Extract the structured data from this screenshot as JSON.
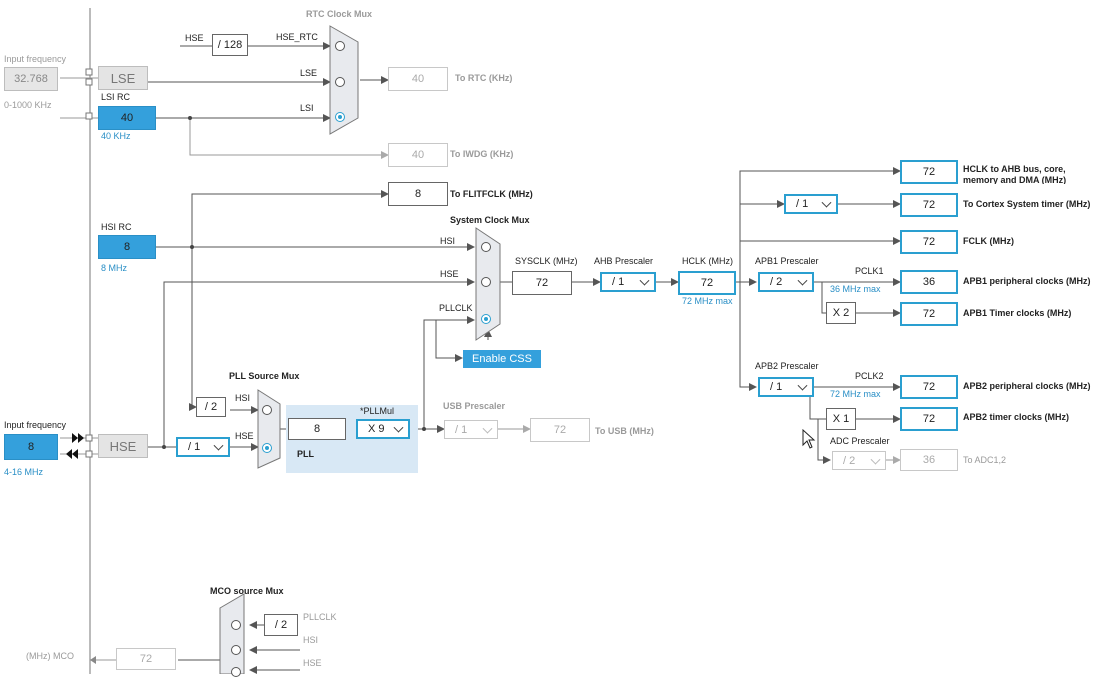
{
  "left": {
    "input_freq_label_top": "Input frequency",
    "lse_input_value": "32.768",
    "lse_range": "0-1000 KHz",
    "input_freq_label_bottom": "Input frequency",
    "hse_input_value": "8",
    "hse_range": "4-16 MHz",
    "mco_label": "(MHz) MCO",
    "mco_value": "72"
  },
  "sources": {
    "lse": "LSE",
    "lsi_rc_title": "LSI RC",
    "lsi_value": "40",
    "lsi_freq": "40 KHz",
    "hsi_rc_title": "HSI RC",
    "hsi_value": "8",
    "hsi_freq": "8 MHz",
    "hse": "HSE"
  },
  "rtc": {
    "title": "RTC Clock Mux",
    "hse_label": "HSE",
    "div128": "/ 128",
    "hse_rtc": "HSE_RTC",
    "lse_label": "LSE",
    "lsi_label": "LSI",
    "rtc_value": "40",
    "rtc_out": "To RTC (KHz)",
    "iwdg_value": "40",
    "iwdg_out": "To IWDG (KHz)"
  },
  "flit": {
    "value": "8",
    "label": "To FLITFCLK (MHz)"
  },
  "sysmux": {
    "title": "System Clock Mux",
    "hsi": "HSI",
    "hse": "HSE",
    "pllclk": "PLLCLK",
    "enable_css": "Enable CSS"
  },
  "sysclk": {
    "title": "SYSCLK (MHz)",
    "value": "72"
  },
  "ahb": {
    "title": "AHB Prescaler",
    "value": "/ 1"
  },
  "hclk": {
    "title": "HCLK (MHz)",
    "value": "72",
    "max": "72 MHz max"
  },
  "outputs": {
    "ahb_value": "72",
    "ahb_label_1": "HCLK to AHB bus, core,",
    "ahb_label_2": "memory and DMA (MHz)",
    "cortex_div": "/ 1",
    "cortex_value": "72",
    "cortex_label": "To Cortex System timer (MHz)",
    "fclk_value": "72",
    "fclk_label": "FCLK (MHz)"
  },
  "apb1": {
    "title": "APB1 Prescaler",
    "value": "/ 2",
    "pclk": "PCLK1",
    "max": "36 MHz max",
    "periph_value": "36",
    "periph_label": "APB1 peripheral clocks (MHz)",
    "timer_mult": "X 2",
    "timer_value": "72",
    "timer_label": "APB1 Timer clocks (MHz)"
  },
  "apb2": {
    "title": "APB2 Prescaler",
    "value": "/ 1",
    "pclk": "PCLK2",
    "max": "72 MHz max",
    "periph_value": "72",
    "periph_label": "APB2 peripheral clocks (MHz)",
    "timer_mult": "X 1",
    "timer_value": "72",
    "timer_label": "APB2 timer clocks (MHz)"
  },
  "adc": {
    "title": "ADC Prescaler",
    "value": "/ 2",
    "out": "36",
    "label": "To ADC1,2"
  },
  "pll": {
    "source_title": "PLL Source Mux",
    "hsi_div": "/ 2",
    "hsi": "HSI",
    "hse": "HSE",
    "hse_div": "/ 1",
    "input": "8",
    "mul_title": "*PLLMul",
    "mul": "X 9",
    "label": "PLL"
  },
  "usb": {
    "title": "USB Prescaler",
    "value": "/ 1",
    "out": "72",
    "label": "To USB (MHz)"
  },
  "mco": {
    "title": "MCO source Mux",
    "div": "/ 2",
    "pllclk": "PLLCLK",
    "hsi": "HSI",
    "hse": "HSE"
  }
}
